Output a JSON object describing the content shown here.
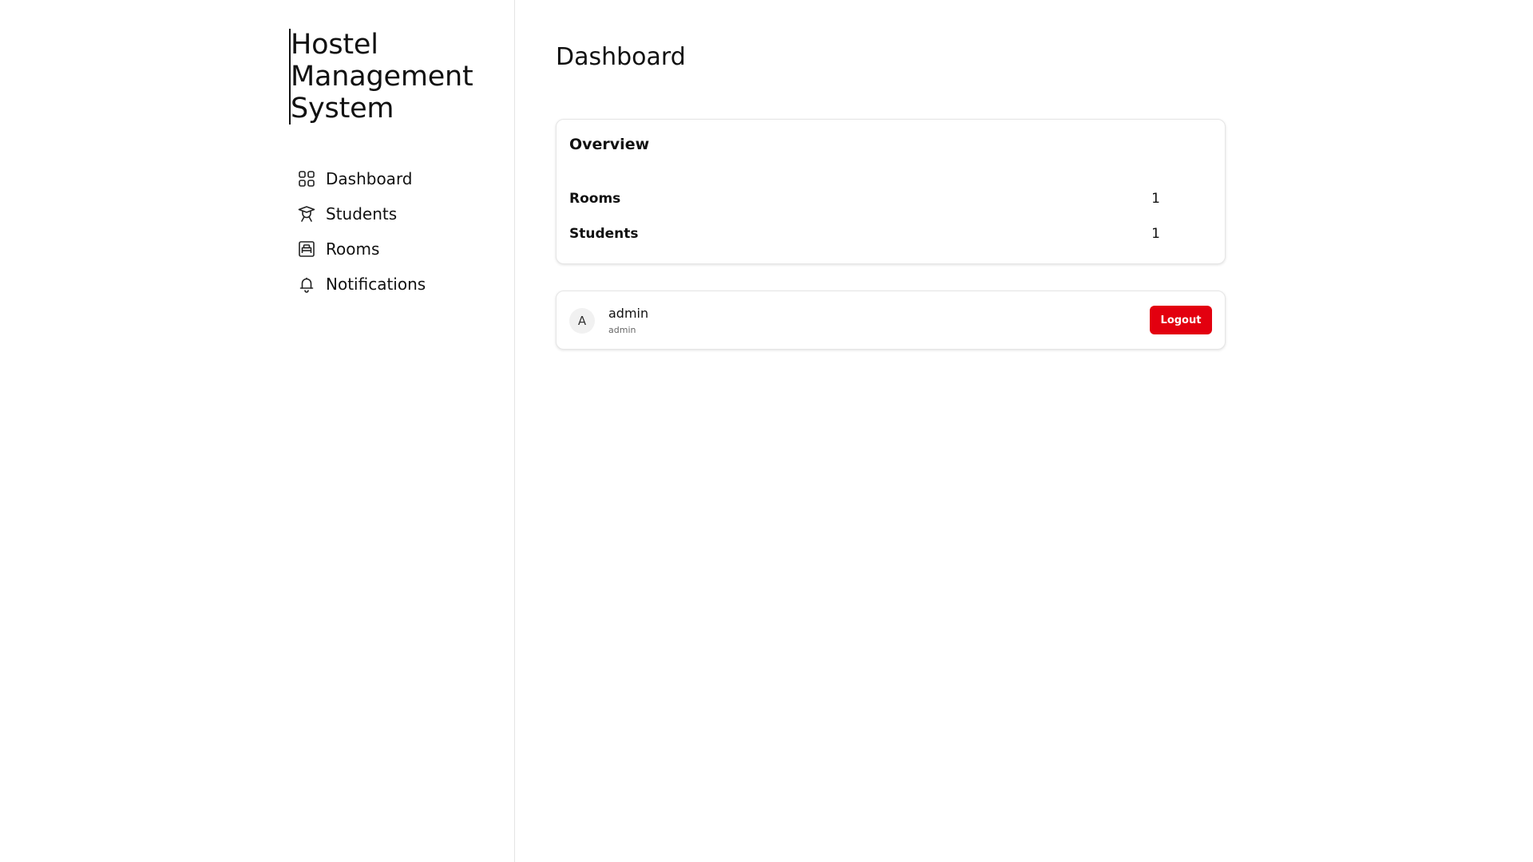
{
  "app": {
    "title": "Hostel Management System"
  },
  "sidebar": {
    "items": [
      {
        "label": "Dashboard",
        "icon": "grid-icon"
      },
      {
        "label": "Students",
        "icon": "student-icon"
      },
      {
        "label": "Rooms",
        "icon": "room-icon"
      },
      {
        "label": "Notifications",
        "icon": "bell-icon"
      }
    ]
  },
  "main": {
    "title": "Dashboard",
    "overview": {
      "title": "Overview",
      "stats": [
        {
          "label": "Rooms",
          "value": "1"
        },
        {
          "label": "Students",
          "value": "1"
        }
      ]
    },
    "user": {
      "avatar_initial": "A",
      "name": "admin",
      "role": "admin",
      "logout_label": "Logout"
    }
  },
  "colors": {
    "accent_danger": "#e3000f",
    "border": "#e6e6e6",
    "text": "#111111"
  }
}
